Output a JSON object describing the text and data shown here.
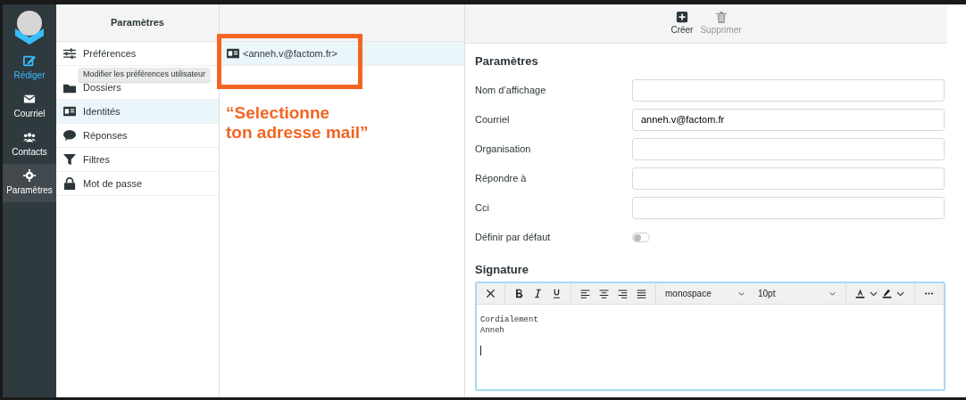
{
  "app_nav": [
    {
      "label": "Rédiger",
      "kind": "compose",
      "selected": false
    },
    {
      "label": "Courriel",
      "kind": "mail",
      "selected": false
    },
    {
      "label": "Contacts",
      "kind": "contacts",
      "selected": false
    },
    {
      "label": "Paramètres",
      "kind": "settings",
      "selected": true
    }
  ],
  "settings_panel": {
    "title": "Paramètres",
    "items": [
      {
        "label": "Préférences",
        "kind": "sliders",
        "selected": false
      },
      {
        "label": "Dossiers",
        "kind": "folder",
        "selected": false
      },
      {
        "label": "Identités",
        "kind": "idcard",
        "selected": true
      },
      {
        "label": "Réponses",
        "kind": "bubble",
        "selected": false
      },
      {
        "label": "Filtres",
        "kind": "filter",
        "selected": false
      },
      {
        "label": "Mot de passe",
        "kind": "lock",
        "selected": false
      }
    ],
    "tooltip": "Modifier les préférences utilisateur"
  },
  "identities": [
    {
      "label": "<anneh.v@factom.fr>",
      "selected": true
    }
  ],
  "annotation": {
    "lines": [
      "“Selectionne",
      "ton adresse mail”"
    ]
  },
  "toolbar": [
    {
      "label": "Créer",
      "kind": "create",
      "disabled": false
    },
    {
      "label": "Supprimer",
      "kind": "delete",
      "disabled": true
    }
  ],
  "form": {
    "title": "Paramètres",
    "fields": [
      {
        "label": "Nom d’affichage"
      },
      {
        "label": "Courriel",
        "value": "anneh.v@factom.fr"
      },
      {
        "label": "Organisation"
      },
      {
        "label": "Répondre à"
      },
      {
        "label": "Cci"
      }
    ],
    "default_toggle": {
      "label": "Définir par défaut",
      "on": false
    }
  },
  "signature": {
    "title": "Signature",
    "font": "monospace",
    "size": "10pt",
    "lines": [
      "Cordialement",
      "Anneh"
    ]
  }
}
